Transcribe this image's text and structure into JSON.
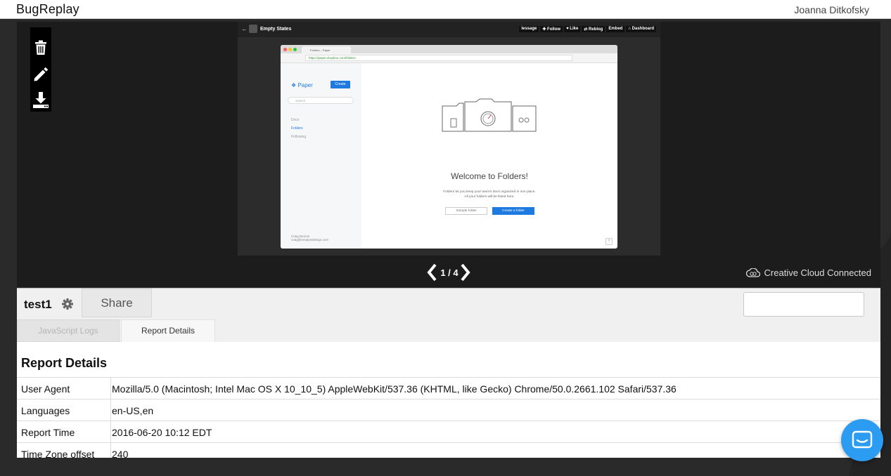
{
  "app": {
    "brand": "BugReplay",
    "user": "Joanna Ditkofsky"
  },
  "tools": [
    {
      "name": "trash-icon"
    },
    {
      "name": "pencil-icon"
    },
    {
      "name": "download-icon"
    }
  ],
  "screenshot": {
    "topbar": {
      "title": "Empty States",
      "nav": [
        "lessage",
        "✚ Follow",
        "♥ Like",
        "⇄ Reblog",
        "Embed",
        "⌂ Dashboard"
      ]
    },
    "browser": {
      "tab_title": "Folders – Paper",
      "url": "https://paper.dropbox.com/folders",
      "logo": "Paper",
      "create": "Create",
      "search_placeholder": "Search",
      "links": [
        "Docs",
        "Folders",
        "Following"
      ],
      "user_name": "Craig Dennis",
      "user_email": "craig@emptystdesign.com",
      "welcome": "Welcome to Folders!",
      "sub1": "Folders let you keep your team's docs organized in one place.",
      "sub2": "All your folders will be listed here.",
      "sample_btn": "Sample folder",
      "create_btn": "Create a folder",
      "help": "?"
    }
  },
  "pager": {
    "current": "1 / 4"
  },
  "cc": {
    "label": "Creative Cloud Connected"
  },
  "report": {
    "name": "test1",
    "share": "Share",
    "tabs": [
      "JavaScript Logs",
      "Report Details"
    ],
    "heading": "Report Details",
    "rows": [
      {
        "key": "User Agent",
        "value": "Mozilla/5.0 (Macintosh; Intel Mac OS X 10_10_5) AppleWebKit/537.36 (KHTML, like Gecko) Chrome/50.0.2661.102 Safari/537.36"
      },
      {
        "key": "Languages",
        "value": "en-US,en"
      },
      {
        "key": "Report Time",
        "value": "2016-06-20 10:12 EDT"
      },
      {
        "key": "Time Zone offset",
        "value": "240"
      }
    ]
  },
  "colors": {
    "accent": "#2c9cf2",
    "paper_blue": "#1f7ae0",
    "dark": "#1c1c1c"
  }
}
